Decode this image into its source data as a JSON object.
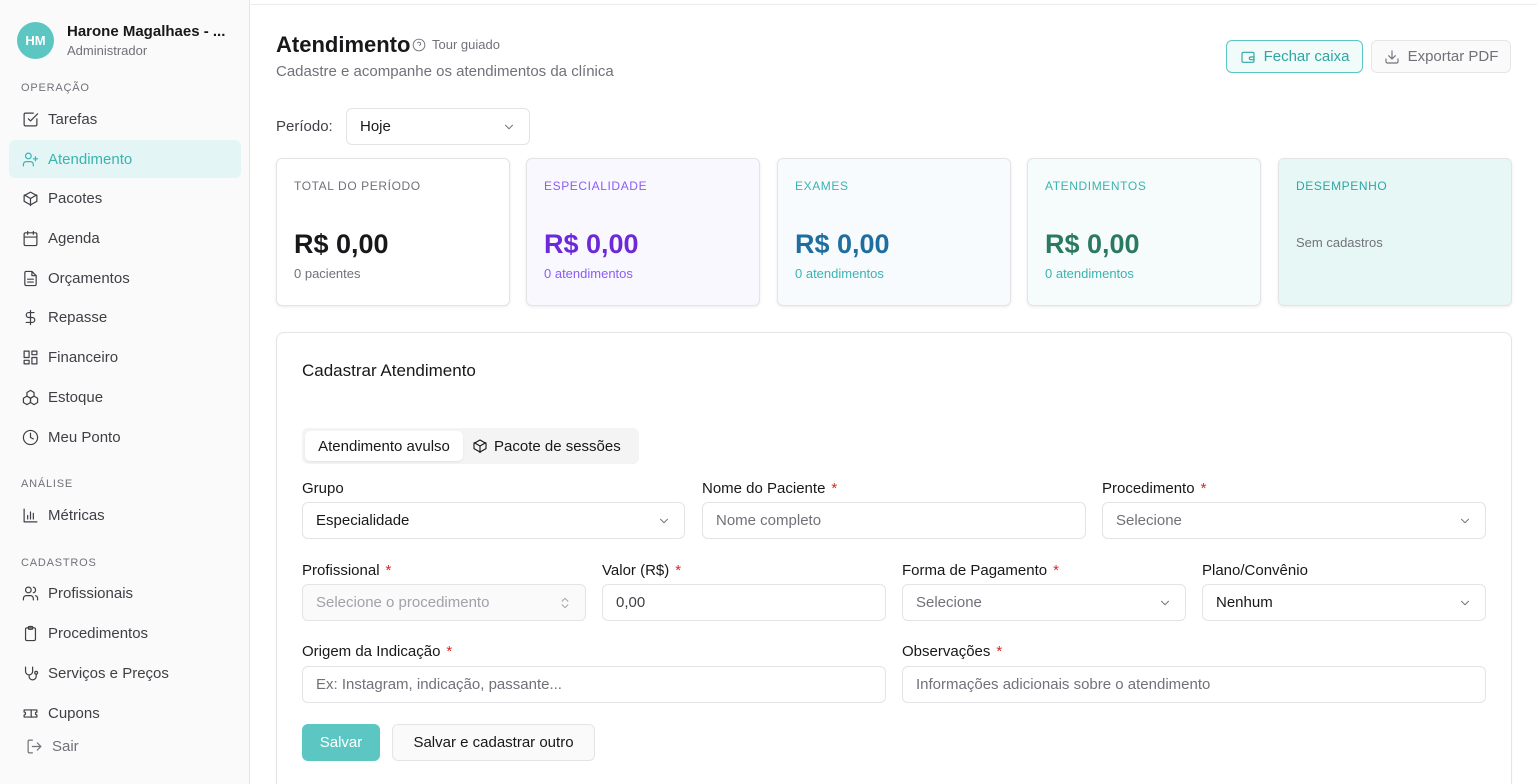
{
  "user": {
    "initials": "HM",
    "name": "Harone Magalhaes - ...",
    "role": "Administrador"
  },
  "sidebar": {
    "sections": [
      {
        "label": "OPERAÇÃO"
      },
      {
        "label": "ANÁLISE"
      },
      {
        "label": "CADASTROS"
      }
    ],
    "items": [
      {
        "label": "Tarefas",
        "icon": "task-check-icon"
      },
      {
        "label": "Atendimento",
        "icon": "user-plus-icon",
        "active": true
      },
      {
        "label": "Pacotes",
        "icon": "package-icon"
      },
      {
        "label": "Agenda",
        "icon": "calendar-icon"
      },
      {
        "label": "Orçamentos",
        "icon": "document-icon"
      },
      {
        "label": "Repasse",
        "icon": "dollar-icon"
      },
      {
        "label": "Financeiro",
        "icon": "grid-icon"
      },
      {
        "label": "Estoque",
        "icon": "boxes-icon"
      },
      {
        "label": "Meu Ponto",
        "icon": "clock-icon"
      },
      {
        "label": "Métricas",
        "icon": "bar-chart-icon"
      },
      {
        "label": "Profissionais",
        "icon": "users-icon"
      },
      {
        "label": "Procedimentos",
        "icon": "clipboard-icon"
      },
      {
        "label": "Serviços e Preços",
        "icon": "stethoscope-icon"
      },
      {
        "label": "Cupons",
        "icon": "ticket-icon"
      }
    ],
    "logout": "Sair"
  },
  "header": {
    "title": "Atendimento",
    "tour": "Tour guiado",
    "subtitle": "Cadastre e acompanhe os atendimentos da clínica",
    "fechar_caixa": "Fechar caixa",
    "exportar_pdf": "Exportar PDF"
  },
  "periodo": {
    "label": "Período:",
    "value": "Hoje"
  },
  "cards": [
    {
      "label": "TOTAL DO PERÍODO",
      "value": "R$ 0,00",
      "sub": "0 pacientes",
      "color": "#18181b",
      "label_color": "#71717a",
      "bg": "#ffffff"
    },
    {
      "label": "ESPECIALIDADE",
      "value": "R$ 0,00",
      "sub": "0 atendimentos",
      "color": "#6d28d9",
      "label_color": "#8b5cf6",
      "bg": "#faf8ff"
    },
    {
      "label": "EXAMES",
      "value": "R$ 0,00",
      "sub": "0 atendimentos",
      "color": "#1e6f9f",
      "label_color": "#3bb3b0",
      "bg": "#f8fbfd"
    },
    {
      "label": "ATENDIMENTOS",
      "value": "R$ 0,00",
      "sub": "0 atendimentos",
      "color": "#2a7a5f",
      "label_color": "#3bb3b0",
      "bg": "#f6fcfb"
    },
    {
      "label": "DESEMPENHO",
      "empty": "Sem cadastros",
      "label_color": "#2fa6a3",
      "bg": "#e6f7f5"
    }
  ],
  "form": {
    "title": "Cadastrar Atendimento",
    "tabs": [
      "Atendimento avulso",
      "Pacote de sessões"
    ],
    "fields": {
      "grupo": {
        "label": "Grupo",
        "value": "Especialidade"
      },
      "paciente": {
        "label": "Nome do Paciente",
        "placeholder": "Nome completo"
      },
      "procedimento": {
        "label": "Procedimento",
        "placeholder": "Selecione"
      },
      "profissional": {
        "label": "Profissional",
        "placeholder": "Selecione o procedimento"
      },
      "valor": {
        "label": "Valor (R$)",
        "value": "0,00"
      },
      "pagamento": {
        "label": "Forma de Pagamento",
        "placeholder": "Selecione"
      },
      "plano": {
        "label": "Plano/Convênio",
        "value": "Nenhum"
      },
      "origem": {
        "label": "Origem da Indicação",
        "placeholder": "Ex: Instagram, indicação, passante..."
      },
      "observacoes": {
        "label": "Observações",
        "placeholder": "Informações adicionais sobre o atendimento"
      }
    },
    "required_mark": "*",
    "save": "Salvar",
    "save_another": "Salvar e cadastrar outro"
  },
  "colors": {
    "accent": "#5cc6c3",
    "required": "#dc2626"
  }
}
